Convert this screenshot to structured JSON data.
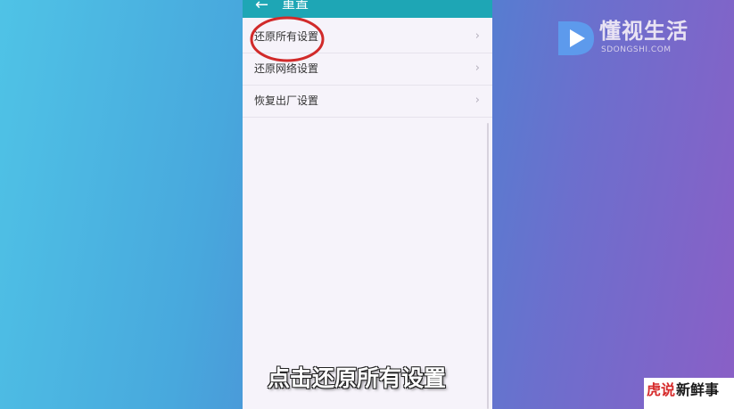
{
  "action_bar": {
    "back_icon": "arrow-left-icon",
    "title": "重置"
  },
  "settings_list": {
    "items": [
      {
        "label": "还原所有设置",
        "chevron": "chevron-right-icon",
        "highlighted": true
      },
      {
        "label": "还原网络设置",
        "chevron": "chevron-right-icon"
      },
      {
        "label": "恢复出厂设置",
        "chevron": "chevron-right-icon"
      }
    ]
  },
  "caption": "点击还原所有设置",
  "logo": {
    "text": "懂视生活",
    "subtext": "SDONGSHI.COM"
  },
  "watermark": {
    "red_part": "虎说",
    "black_part": "新鲜事"
  },
  "colors": {
    "action_bar": "#1ea6b5",
    "highlight_circle": "#d12a2a",
    "screen_background": "#f6f3fa"
  }
}
